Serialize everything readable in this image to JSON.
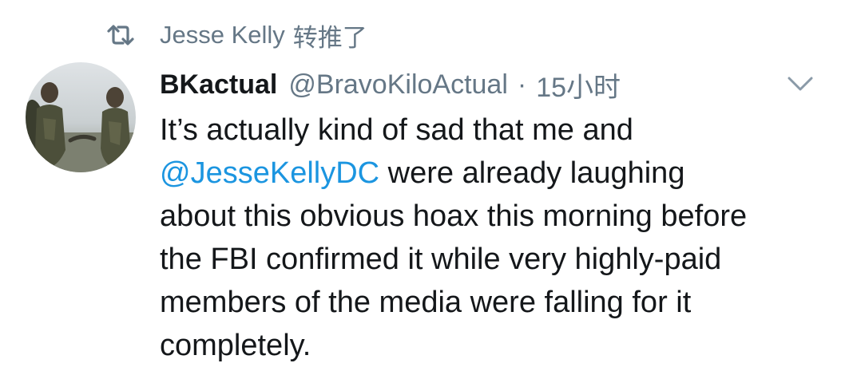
{
  "retweet": {
    "icon": "retweet-icon",
    "retweeter_name": "Jesse Kelly",
    "action_label": "转推了"
  },
  "tweet": {
    "author_name": "BKactual",
    "handle": "@BravoKiloActual",
    "separator": "·",
    "timestamp": "15小时",
    "menu_icon": "chevron-down-icon",
    "avatar_icon": "avatar",
    "body_lines": [
      {
        "text_before": "It’s actually kind of sad that me and"
      },
      {
        "mention": "@JesseKellyDC",
        "text_after": " were already laughing"
      },
      {
        "text_before": "about this obvious hoax this morning before"
      },
      {
        "text_before": "the FBI confirmed it while very highly-paid"
      },
      {
        "text_before": "members of the media were falling for it"
      },
      {
        "text_before": "completely."
      }
    ]
  },
  "colors": {
    "text_primary": "#14171a",
    "text_secondary": "#657786",
    "link": "#1b95e0",
    "background": "#ffffff"
  }
}
